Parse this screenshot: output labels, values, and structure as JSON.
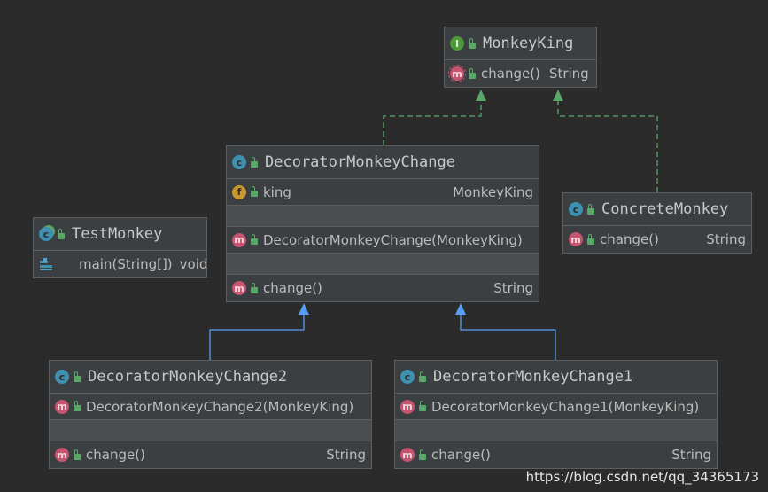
{
  "colors": {
    "background": "#2b2b2b",
    "node_fill": "#3c3f41",
    "empty_row": "#4b4e50",
    "implements_edge": "#59a869",
    "extends_edge": "#589df6"
  },
  "nodes": {
    "monkey_king": {
      "title": "MonkeyKing",
      "kind_icon": "interface-icon",
      "methods": [
        {
          "name": "change()",
          "type": "String"
        }
      ]
    },
    "decorator": {
      "title": "DecoratorMonkeyChange",
      "kind_icon": "class-icon",
      "fields": [
        {
          "name": "king",
          "type": "MonkeyKing"
        }
      ],
      "constructors": [
        {
          "name": "DecoratorMonkeyChange(MonkeyKing)"
        }
      ],
      "methods": [
        {
          "name": "change()",
          "type": "String"
        }
      ]
    },
    "concrete": {
      "title": "ConcreteMonkey",
      "kind_icon": "class-icon",
      "methods": [
        {
          "name": "change()",
          "type": "String"
        }
      ]
    },
    "test": {
      "title": "TestMonkey",
      "kind_icon": "runnable-class-icon",
      "methods": [
        {
          "name": "main(String[])",
          "type": "void"
        }
      ]
    },
    "decorator2": {
      "title": "DecoratorMonkeyChange2",
      "kind_icon": "class-icon",
      "constructors": [
        {
          "name": "DecoratorMonkeyChange2(MonkeyKing)"
        }
      ],
      "methods": [
        {
          "name": "change()",
          "type": "String"
        }
      ]
    },
    "decorator1": {
      "title": "DecoratorMonkeyChange1",
      "kind_icon": "class-icon",
      "constructors": [
        {
          "name": "DecoratorMonkeyChange1(MonkeyKing)"
        }
      ],
      "methods": [
        {
          "name": "change()",
          "type": "String"
        }
      ]
    }
  },
  "edges": [
    {
      "from": "DecoratorMonkeyChange",
      "to": "MonkeyKing",
      "kind": "implements"
    },
    {
      "from": "ConcreteMonkey",
      "to": "MonkeyKing",
      "kind": "implements"
    },
    {
      "from": "DecoratorMonkeyChange2",
      "to": "DecoratorMonkeyChange",
      "kind": "extends"
    },
    {
      "from": "DecoratorMonkeyChange1",
      "to": "DecoratorMonkeyChange",
      "kind": "extends"
    }
  ],
  "watermark": "https://blog.csdn.net/qq_34365173"
}
